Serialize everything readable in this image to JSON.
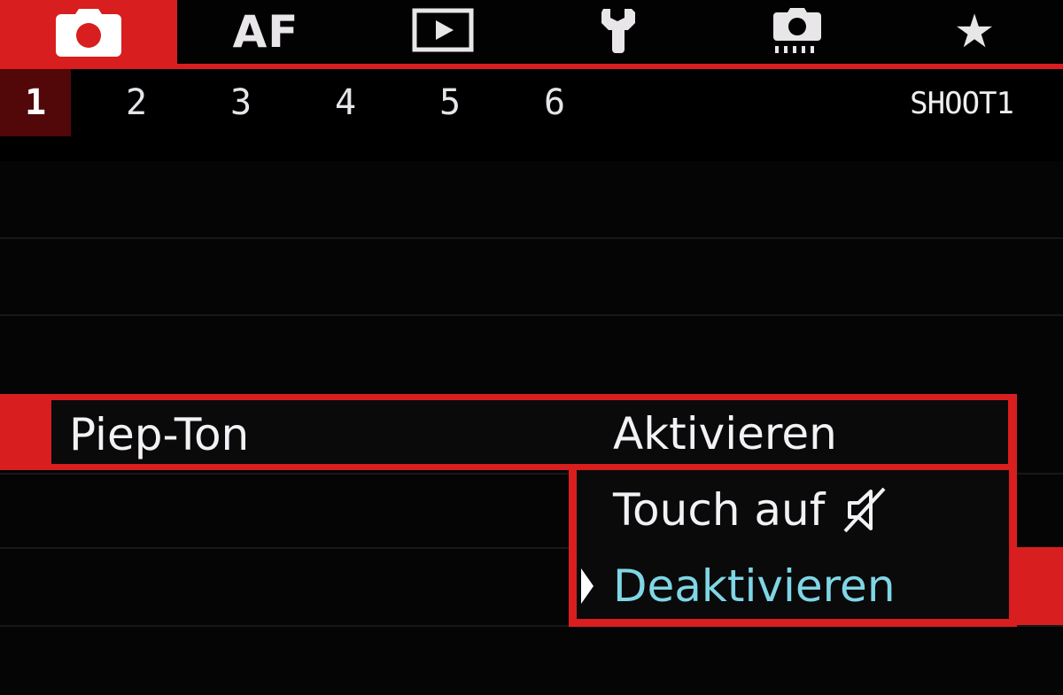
{
  "tabs": [
    {
      "id": "shoot",
      "icon": "camera-icon",
      "active": true
    },
    {
      "id": "af",
      "label": "AF",
      "active": false
    },
    {
      "id": "playback",
      "icon": "playback-icon",
      "active": false
    },
    {
      "id": "setup",
      "icon": "wrench-icon",
      "active": false
    },
    {
      "id": "custom",
      "icon": "custom-functions-camera-icon",
      "active": false
    },
    {
      "id": "mymenu",
      "icon": "star-icon",
      "active": false
    }
  ],
  "pages": [
    "1",
    "2",
    "3",
    "4",
    "5",
    "6"
  ],
  "active_page": "1",
  "menu_code": "SHOOT1",
  "setting": {
    "label": "Piep-Ton",
    "options": [
      {
        "label": "Aktivieren",
        "icon": null
      },
      {
        "label": "Touch auf",
        "icon": "speaker-mute-icon"
      },
      {
        "label": "Deaktivieren",
        "icon": null
      }
    ],
    "selected_option": "Deaktivieren"
  },
  "colors": {
    "accent_red": "#d81e1e",
    "active_page_bg": "#520708",
    "selected_text": "#7fd6e6",
    "text": "#f0eef0",
    "background": "#000000"
  }
}
